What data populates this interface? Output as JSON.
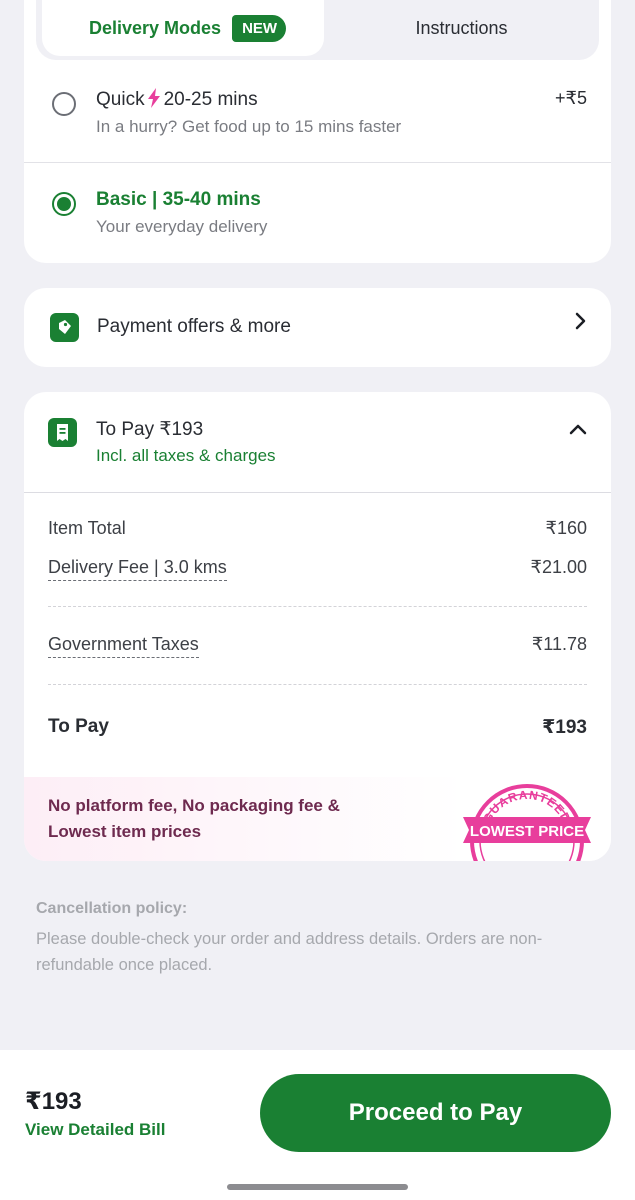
{
  "delivery": {
    "tabs": [
      {
        "label": "Delivery Modes",
        "badge": "NEW",
        "active": true
      },
      {
        "label": "Instructions",
        "active": false
      }
    ],
    "modes": [
      {
        "name": "Quick",
        "time": "20-25 mins",
        "subtitle": "In a hurry? Get food up to 15 mins faster",
        "price": "+₹5",
        "selected": false
      },
      {
        "name": "Basic | 35-40 mins",
        "subtitle": "Your everyday delivery",
        "selected": true
      }
    ]
  },
  "offers": {
    "label": "Payment offers & more"
  },
  "bill": {
    "title": "To Pay ₹193",
    "subtitle": "Incl. all taxes & charges",
    "rows": [
      {
        "label": "Item Total",
        "value": "₹160"
      },
      {
        "label": "Delivery Fee | 3.0 kms",
        "value": "₹21.00"
      },
      {
        "label": "Government Taxes",
        "value": "₹11.78"
      }
    ],
    "total": {
      "label": "To Pay",
      "value": "₹193"
    },
    "promo": "No platform fee, No packaging fee & Lowest item prices",
    "seal": {
      "top": "GUARANTEED",
      "ribbon": "LOWEST PRICE"
    }
  },
  "cancellation": {
    "heading": "Cancellation policy:",
    "text": "Please double-check your order and address details. Orders are non-refundable once placed."
  },
  "footer": {
    "amount": "₹193",
    "link": "View Detailed Bill",
    "button": "Proceed to Pay"
  },
  "colors": {
    "accent": "#1a8033",
    "promo_pink": "#e83e9c"
  }
}
